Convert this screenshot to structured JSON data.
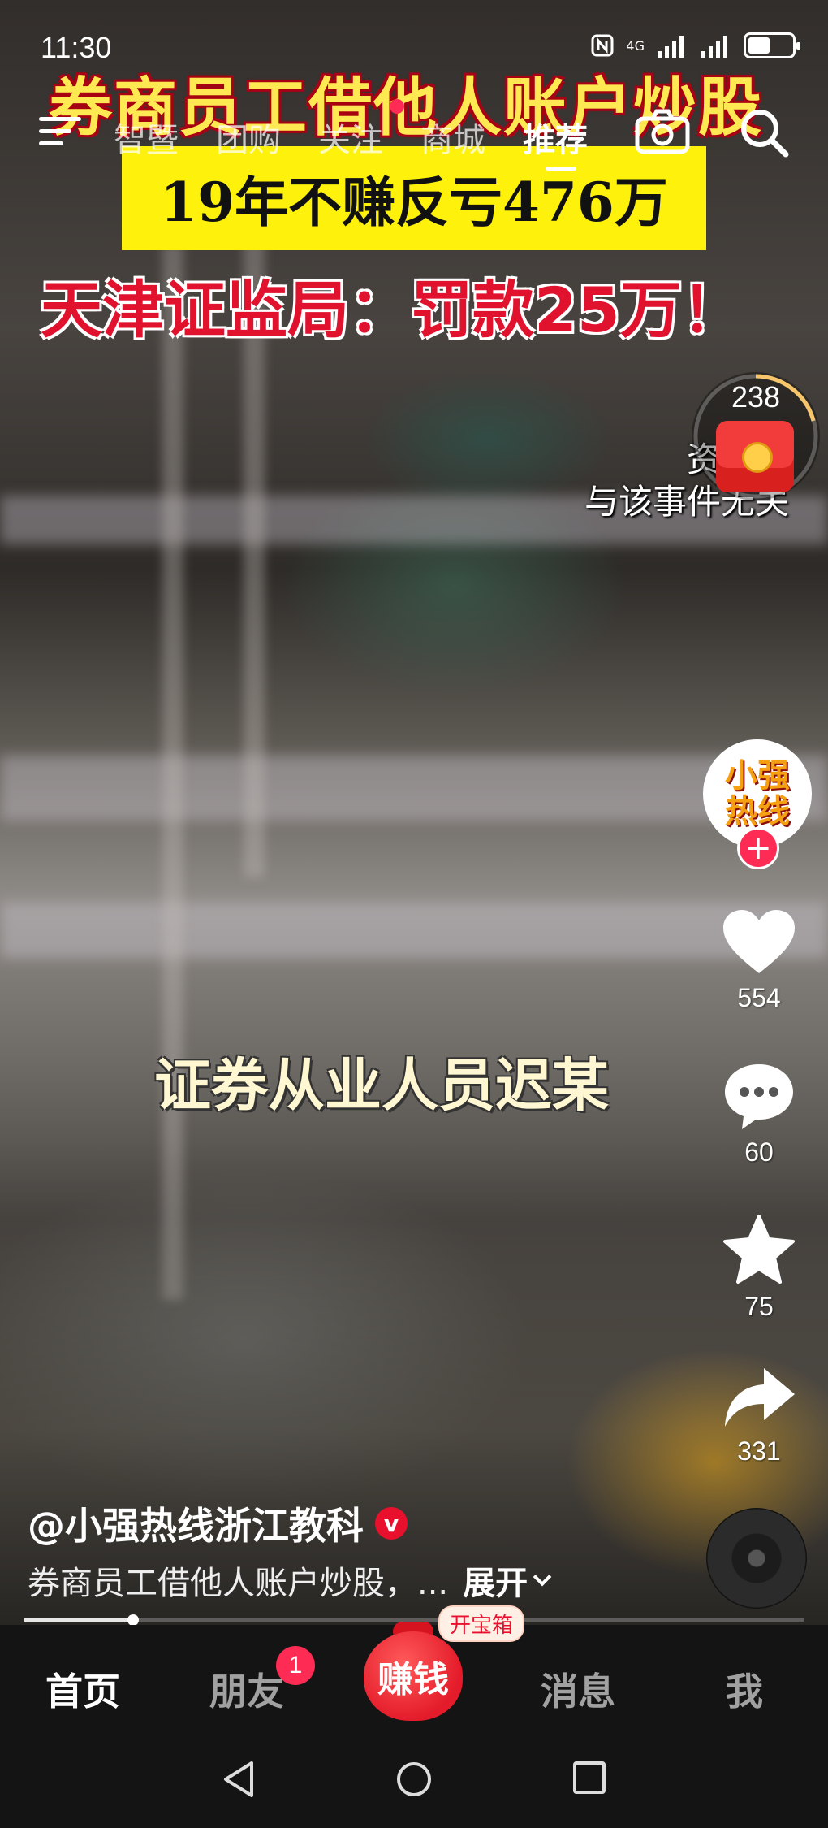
{
  "status_bar": {
    "time": "11:30",
    "nfc_icon": "nfc-icon",
    "network_label": "4G",
    "signal_icons": [
      "signal-4g-icon",
      "signal-icon"
    ],
    "battery_icon": "battery-icon"
  },
  "video": {
    "headline": "券商员工借他人账户炒股",
    "yellow_box_text": "19年不赚反亏476万",
    "red_line": "天津证监局：罚款25万！",
    "disclaimer_line1": "资料画",
    "disclaimer_line2": "与该事件无关",
    "subtitle": "证券从业人员迟某",
    "progress_fraction": 0.14
  },
  "top_nav": {
    "menu_icon": "menu-icon",
    "tabs": [
      "智暨",
      "团购",
      "关注",
      "商城",
      "推荐"
    ],
    "active_tab": "推荐",
    "camera_icon": "camera-icon",
    "search_icon": "search-icon"
  },
  "red_packet": {
    "count": "238",
    "icon": "red-envelope-icon"
  },
  "right_rail": {
    "avatar_text": "小强热线",
    "follow_icon": "plus-icon",
    "like_count": "554",
    "comment_count": "60",
    "favorite_count": "75",
    "share_count": "331",
    "music_disc_icon": "music-disc-icon"
  },
  "caption": {
    "author": "@小强热线浙江教科",
    "verified_mark": "v",
    "description": "券商员工借他人账户炒股，...",
    "expand_label": "展开"
  },
  "tab_bar": {
    "home": "首页",
    "friends": "朋友",
    "friends_badge": "1",
    "earn": "赚钱",
    "treasure_label": "开宝箱",
    "messages": "消息",
    "me": "我"
  },
  "colors": {
    "accent_red": "#fe2c55",
    "headline_yellow": "#ffe94a",
    "tab_bar_bg": "#141414"
  }
}
